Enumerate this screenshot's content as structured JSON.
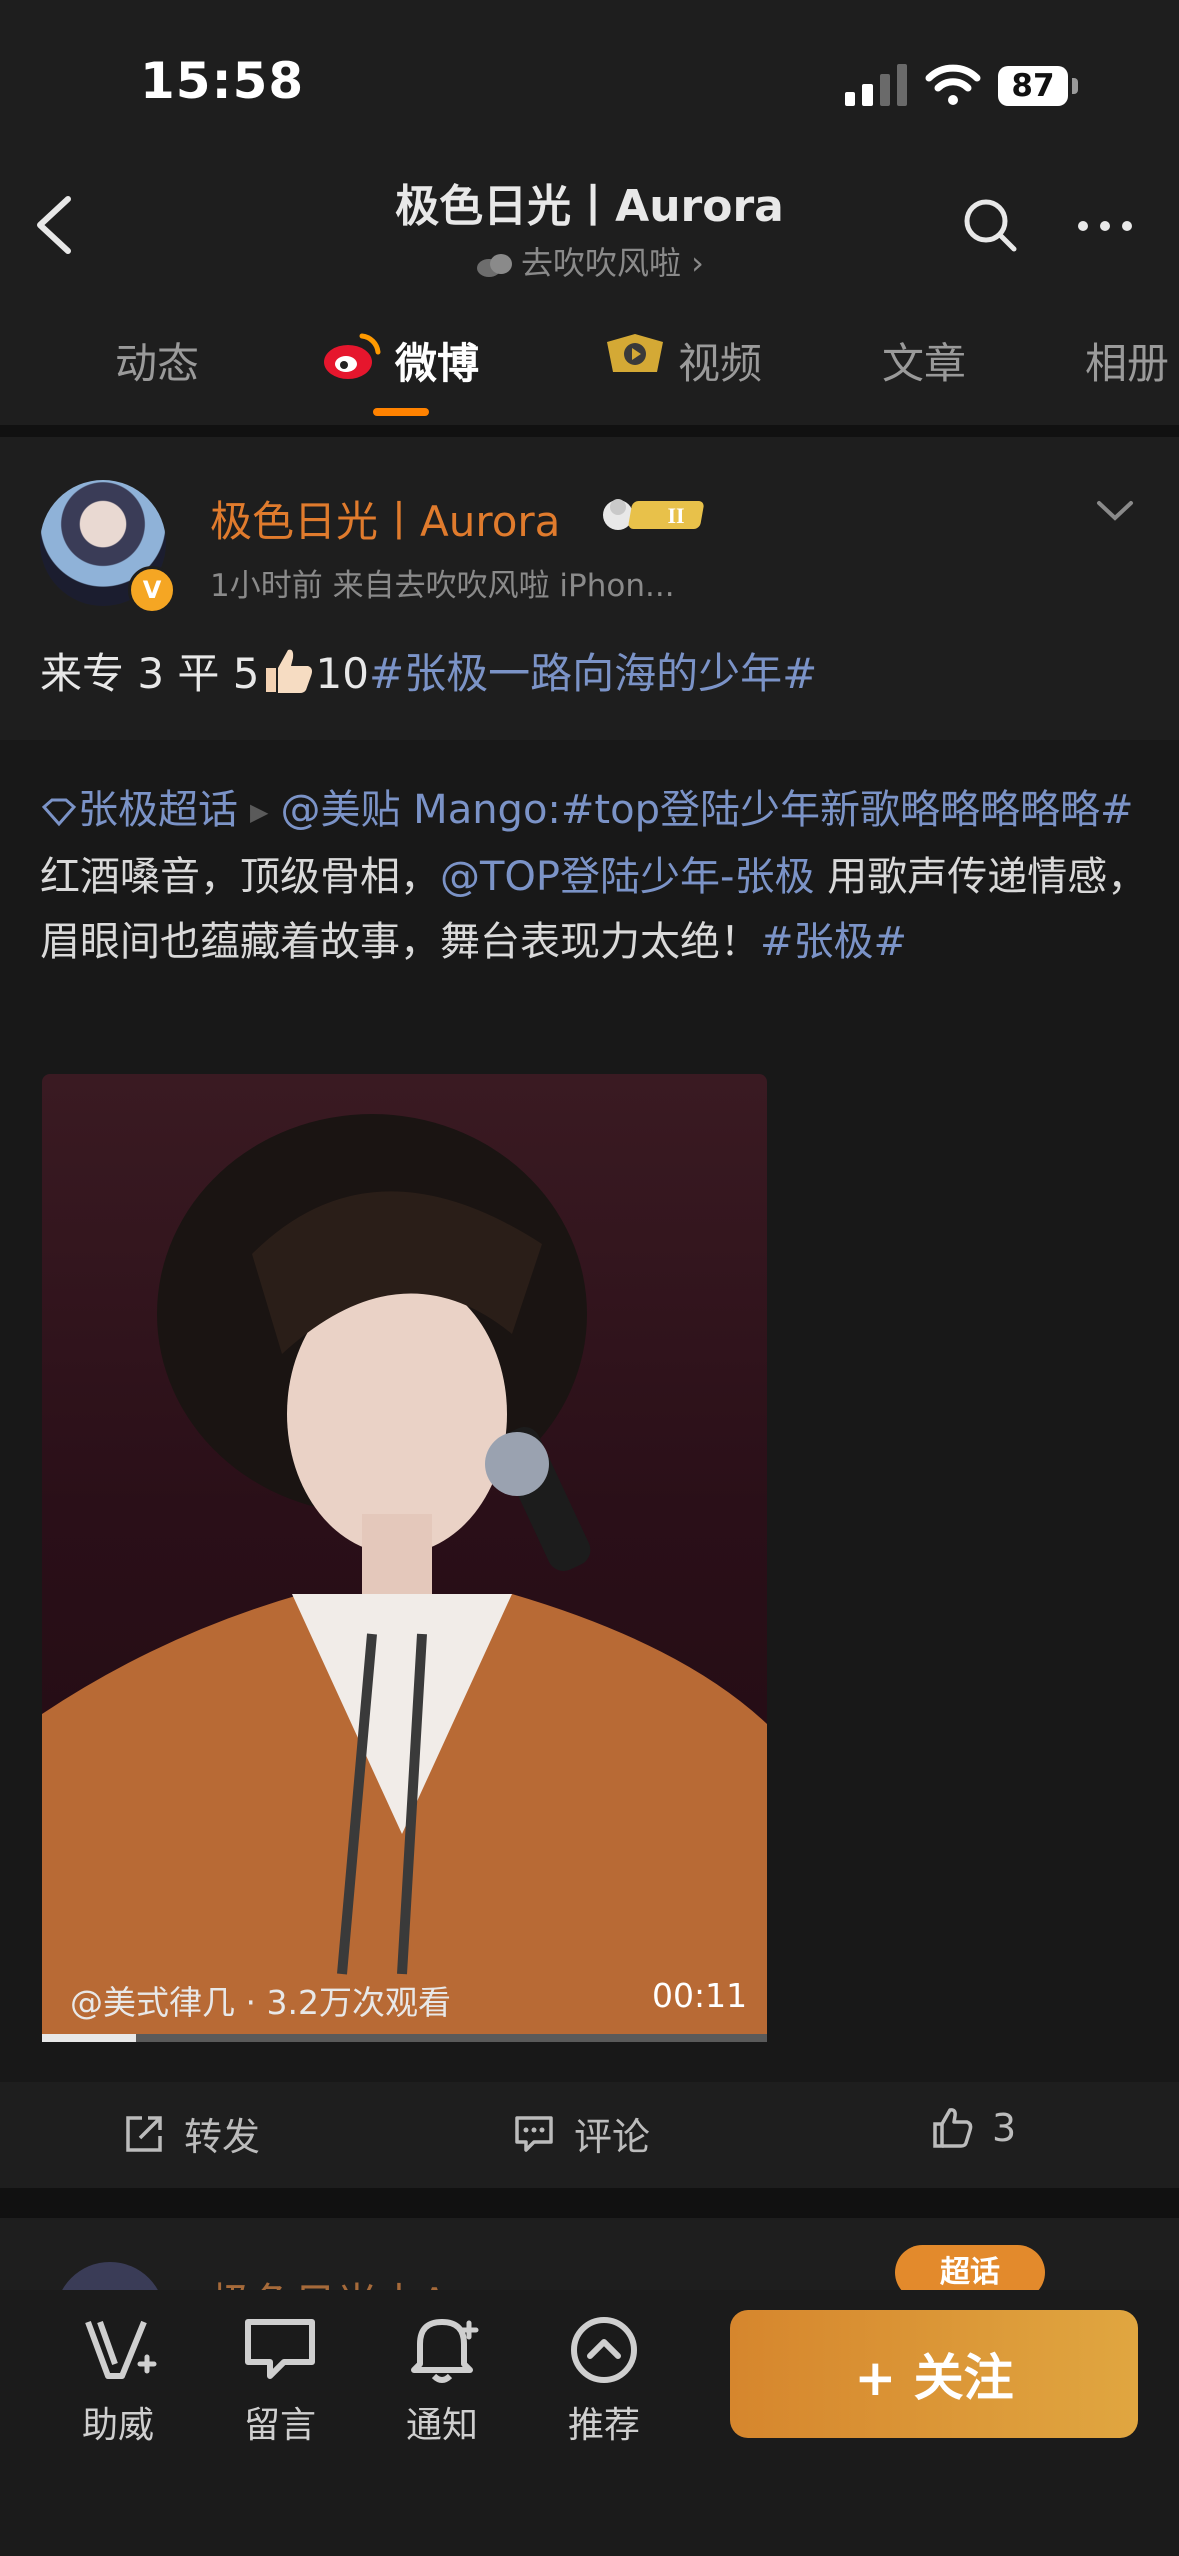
{
  "status": {
    "time": "15:58",
    "battery": "87"
  },
  "header": {
    "title": "极色日光丨Aurora",
    "subtitle": "去吹吹风啦 ›"
  },
  "tabs": [
    {
      "label": "动态"
    },
    {
      "label": "微博"
    },
    {
      "label": "视频"
    },
    {
      "label": "文章"
    },
    {
      "label": "相册"
    }
  ],
  "post": {
    "author": "极色日光丨Aurora",
    "badge": "II",
    "meta": "1小时前  来自去吹吹风啦 iPhon...",
    "text_plain": "来专 3 平 5",
    "text_num": "10",
    "text_tag": "#张极一路向海的少年#",
    "retweet": {
      "supertopic": "张极超话",
      "mention1": "@美贴 Mango:#top登陆少年新歌略略略略略#",
      "body1": " 红酒嗓音，顶级骨相，",
      "mention2": "@TOP登陆少年-张极",
      "body2": " 用歌声传递情感，眉眼间也蕴藏着故事，舞台表现力太绝！",
      "tag": "#张极#"
    },
    "video": {
      "caption": "@美式律几 · 3.2万次观看",
      "duration": "00:11",
      "progress": 0.13
    },
    "actions": {
      "repost": "转发",
      "comment": "评论",
      "like_count": "3"
    }
  },
  "next_post": {
    "author": "极色日光丨Aurora",
    "super_label": "超话"
  },
  "bottom_bar": {
    "items": [
      {
        "label": "助威"
      },
      {
        "label": "留言"
      },
      {
        "label": "通知"
      },
      {
        "label": "推荐"
      }
    ],
    "follow_label": "+ 关注"
  },
  "colors": {
    "accent": "#ff8200",
    "link": "#7b93c7",
    "author": "#e07b2d",
    "follow": "#d6862d"
  }
}
